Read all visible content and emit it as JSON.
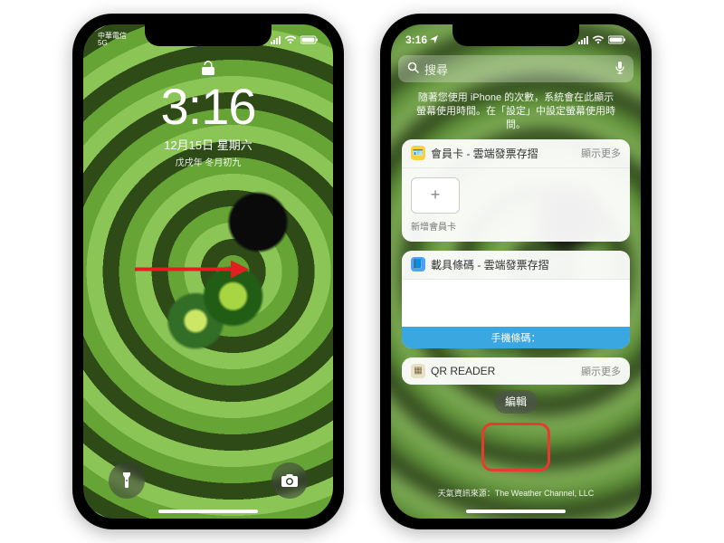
{
  "left_phone": {
    "status": {
      "carrier_line1": "中華電信",
      "carrier_line2": "5G",
      "location_indicator": "◀"
    },
    "lock": {
      "time": "3:16",
      "date": "12月15日 星期六",
      "lunar": "戊戌年 冬月初九"
    },
    "controls": {
      "flashlight": "flashlight",
      "camera": "camera"
    }
  },
  "right_phone": {
    "status": {
      "time": "3:16",
      "location_indicator": "◀"
    },
    "search": {
      "placeholder": "搜尋"
    },
    "screen_time_info": "隨著您使用 iPhone 的次數，系統會在此顯示螢幕使用時間。在「設定」中設定螢幕使用時間。",
    "widgets": [
      {
        "icon_bg": "#ffcf3f",
        "icon_glyph": "🪪",
        "title": "會員卡 - 雲端發票存摺",
        "more": "顯示更多",
        "body_type": "add_card",
        "add_label": "新增會員卡",
        "add_glyph": "+"
      },
      {
        "icon_bg": "#4aa3ff",
        "icon_glyph": "📘",
        "title": "載具條碼 - 雲端發票存摺",
        "more": "",
        "body_type": "barcode",
        "barcode_label": "手機條碼："
      },
      {
        "icon_bg": "#e9e1c7",
        "icon_glyph": "▦",
        "title": "QR READER",
        "more": "顯示更多",
        "body_type": "none"
      }
    ],
    "edit_button": "編輯",
    "attribution": "天氣資訊來源：The Weather Channel, LLC"
  }
}
